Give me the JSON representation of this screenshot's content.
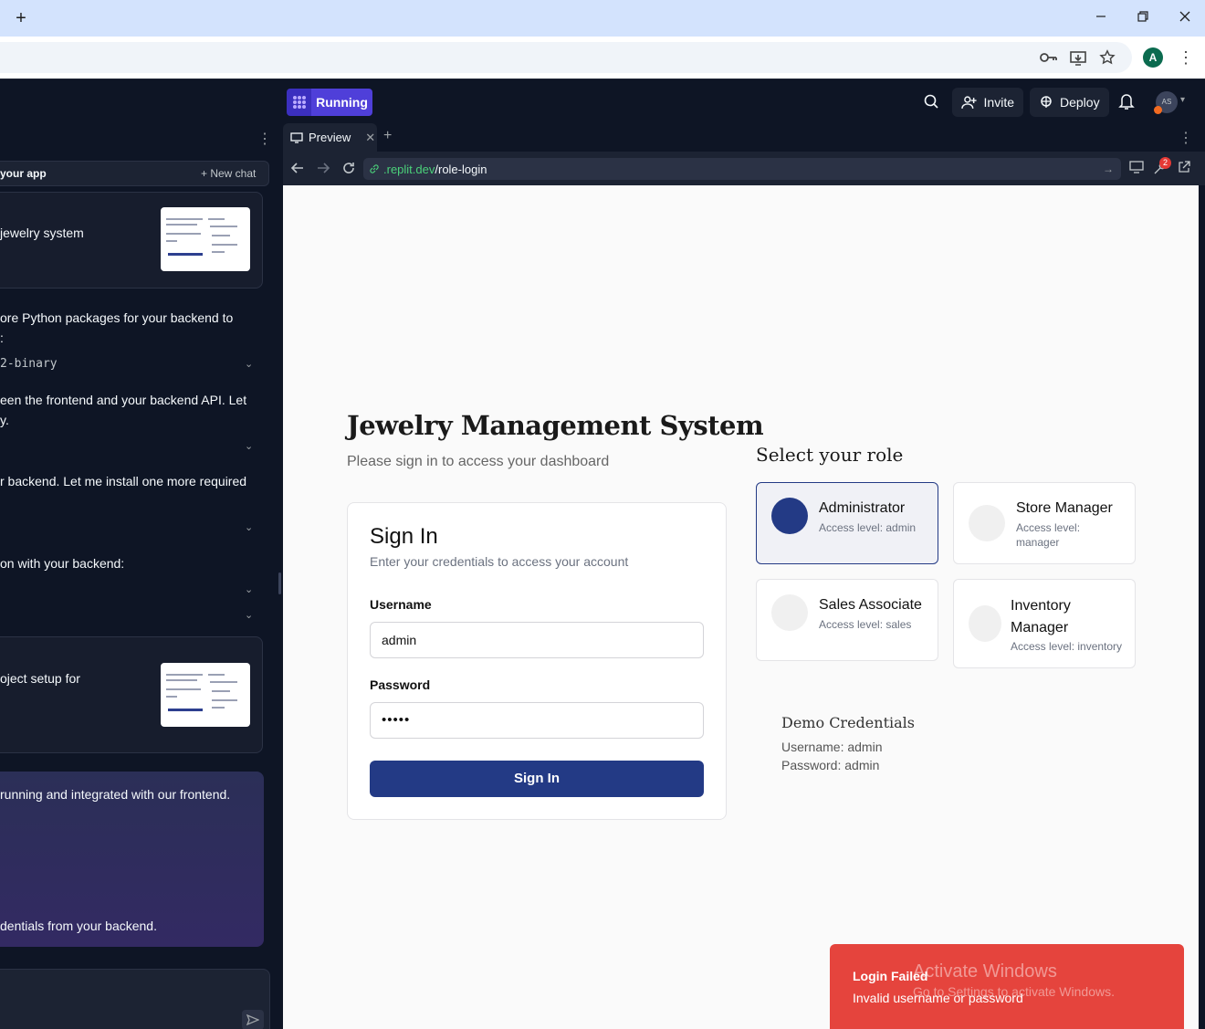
{
  "browser": {
    "new_tab": "+",
    "profile_initial": "A"
  },
  "replit": {
    "run_label": "Running",
    "invite_label": "Invite",
    "deploy_label": "Deploy",
    "avatar_initials": "AS"
  },
  "chat": {
    "bar_title": "your app",
    "new_chat_label": "New chat",
    "card1_text": "jewelry system",
    "msg1": "ore Python packages for your backend to",
    "msg1b": ":",
    "code1": "2-binary",
    "msg2": "een the frontend and your backend API. Let",
    "msg2b": "y.",
    "msg3": "r backend. Let me install one more required",
    "msg4": "on with your backend:",
    "card2_text": "oject setup for",
    "msg5": "running and integrated with our frontend.",
    "msg6": "dentials from your backend."
  },
  "preview": {
    "tab_label": "Preview",
    "url_host": ".replit.dev",
    "url_path": "/role-login",
    "badge_count": "2"
  },
  "app": {
    "title": "Jewelry Management System",
    "subtitle": "Please sign in to access your dashboard",
    "signin": {
      "title": "Sign In",
      "subtitle": "Enter your credentials to access your account",
      "username_label": "Username",
      "username_value": "admin",
      "password_label": "Password",
      "password_value": "•••••",
      "button": "Sign In"
    },
    "roles_title": "Select your role",
    "roles": [
      {
        "name": "Administrator",
        "level": "Access level: admin",
        "selected": true
      },
      {
        "name": "Store Manager",
        "level": "Access level: manager",
        "selected": false
      },
      {
        "name": "Sales Associate",
        "level": "Access level: sales",
        "selected": false
      },
      {
        "name": "Inventory Manager",
        "level": "Access level: inventory",
        "selected": false
      }
    ],
    "demo": {
      "title": "Demo Credentials",
      "username": "Username: admin",
      "password": "Password: admin"
    }
  },
  "toast": {
    "title": "Login Failed",
    "description": "Invalid username or password"
  },
  "watermark": {
    "line1": "Activate Windows",
    "line2": "Go to Settings to activate Windows."
  },
  "colors": {
    "primary": "#233a85",
    "toast": "#e5443d",
    "run": "#4f3fd9",
    "url_host": "#4bd17a"
  }
}
